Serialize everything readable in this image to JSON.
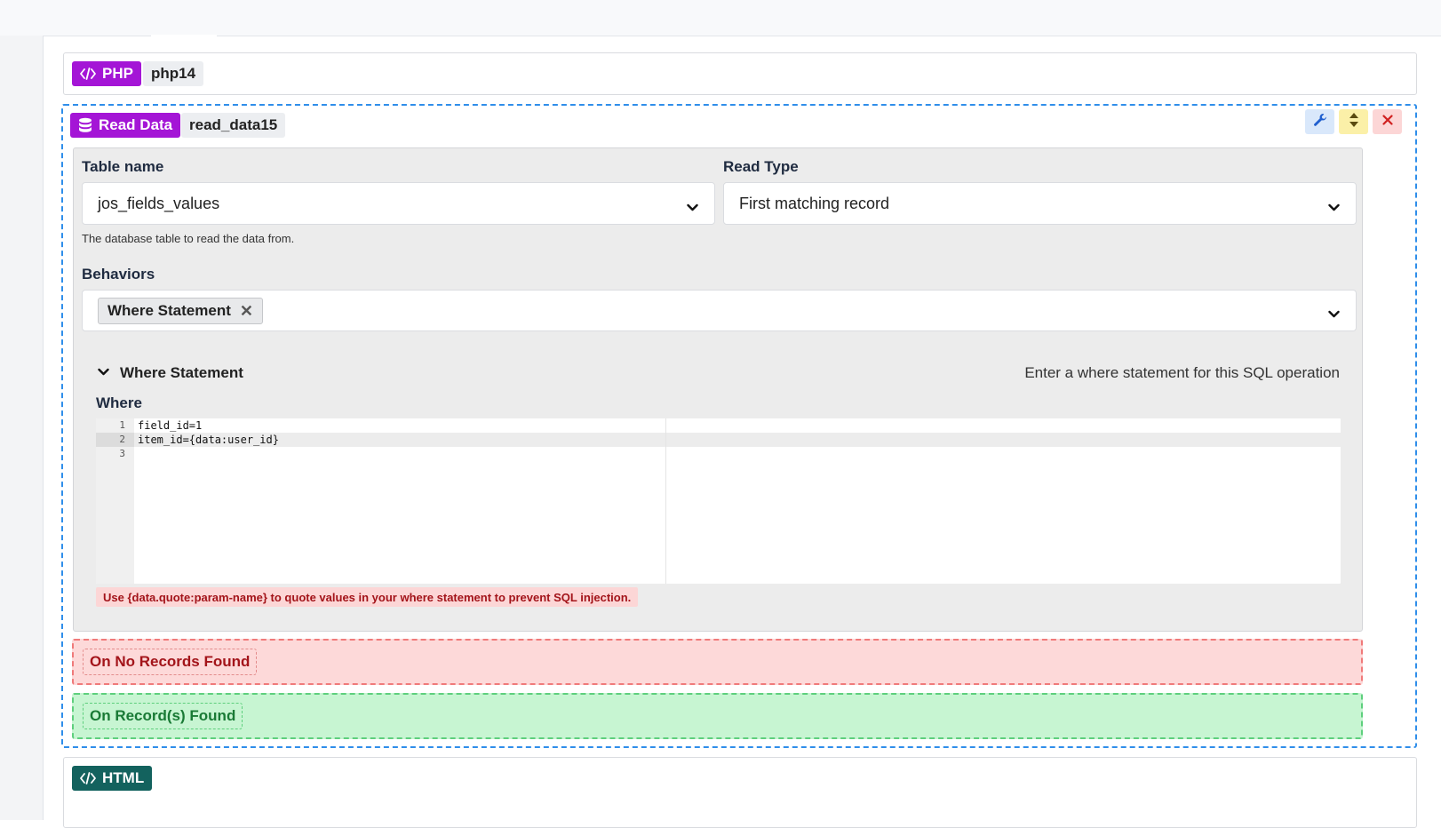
{
  "php_block": {
    "tag": "PHP",
    "name": "php14"
  },
  "read_block": {
    "tag": "Read Data",
    "name": "read_data15",
    "table_name": {
      "label": "Table name",
      "value": "jos_fields_values",
      "hint": "The database table to read the data from."
    },
    "read_type": {
      "label": "Read Type",
      "value": "First matching record"
    },
    "behaviors": {
      "label": "Behaviors",
      "selected": [
        "Where Statement"
      ]
    },
    "where_section": {
      "title": "Where Statement",
      "description": "Enter a where statement for this SQL operation",
      "label": "Where",
      "lines": [
        {
          "num": "1",
          "text": "field_id=1"
        },
        {
          "num": "2",
          "text": "item_id={data:user_id}"
        },
        {
          "num": "3",
          "text": ""
        }
      ],
      "warning": "Use {data.quote:param-name} to quote values in your where statement to prevent SQL injection."
    },
    "events": {
      "no_records": "On No Records Found",
      "records_found": "On Record(s) Found"
    }
  },
  "html_block": {
    "tag": "HTML"
  },
  "colors": {
    "accent_purple": "#a415d6",
    "html_teal": "#13625e",
    "selection_blue": "#2f8eea"
  }
}
